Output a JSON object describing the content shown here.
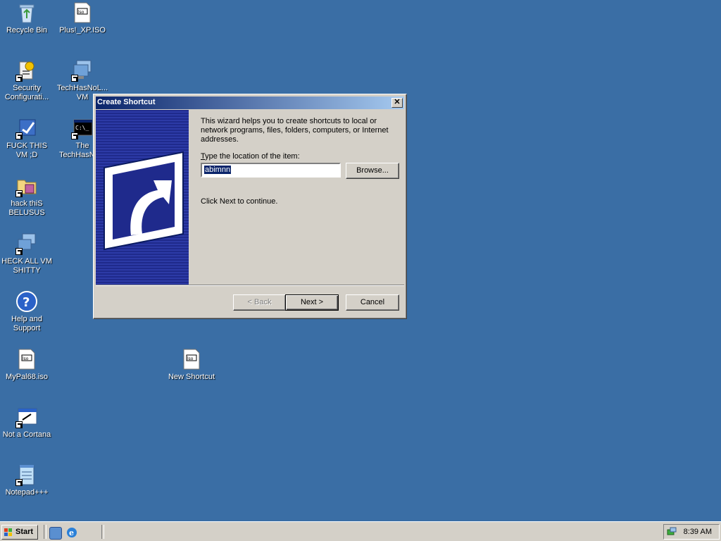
{
  "desktop": {
    "icons": [
      {
        "label": "Recycle Bin"
      },
      {
        "label": "Plus!_XP.ISO"
      },
      {
        "label": "Security Configurati..."
      },
      {
        "label": "TechHasNoL... VM"
      },
      {
        "label": "FUCK THIS VM ;D"
      },
      {
        "label": "The TechHasNo..."
      },
      {
        "label": "hack thiS BELUSUS"
      },
      {
        "label": "HECK ALL VM SHITTY"
      },
      {
        "label": "Help and Support"
      },
      {
        "label": "MyPal68.iso"
      },
      {
        "label": "New Shortcut"
      },
      {
        "label": "Not a Cortana"
      },
      {
        "label": "Notepad+++"
      }
    ]
  },
  "dialog": {
    "title": "Create Shortcut",
    "close_label": "✕",
    "intro": "This wizard helps you to create shortcuts to local or network programs, files, folders, computers, or Internet addresses.",
    "location_label_accel": "T",
    "location_label_rest": "ype the location of the item:",
    "location_value": "abimnn",
    "browse_label": "Browse...",
    "continue_text": "Click Next to continue.",
    "back_label": "< Back",
    "next_label": "Next >",
    "cancel_label": "Cancel"
  },
  "taskbar": {
    "start_label": "Start",
    "clock": "8:39 AM"
  },
  "colors": {
    "desktop": "#3a6ea5",
    "title_gradient_start": "#0a246a",
    "title_gradient_end": "#a6caf0",
    "face": "#d4d0c8",
    "banner": "#1f2a8c"
  }
}
